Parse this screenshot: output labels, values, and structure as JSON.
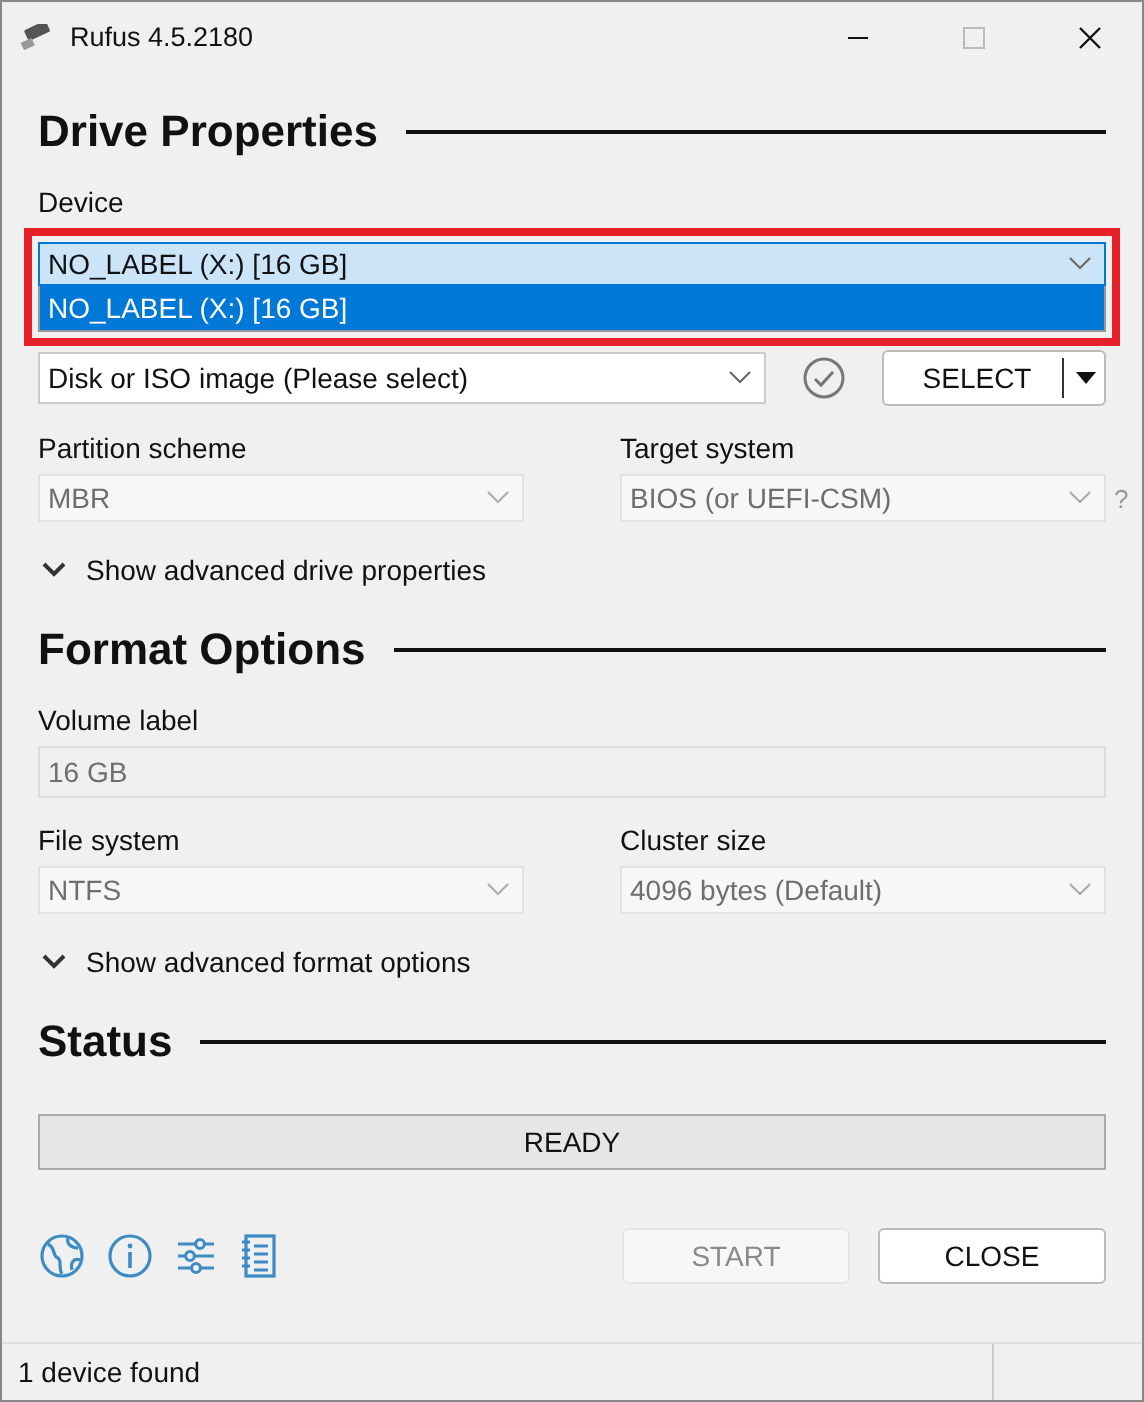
{
  "window": {
    "title": "Rufus 4.5.2180"
  },
  "drive_properties": {
    "heading": "Drive Properties",
    "device": {
      "label": "Device",
      "value": "NO_LABEL (X:) [16 GB]",
      "expanded": true,
      "highlighted": true,
      "options": [
        {
          "label": "NO_LABEL (X:) [16 GB]",
          "selected": true
        }
      ]
    },
    "boot_selection": {
      "value": "Disk or ISO image (Please select)"
    },
    "select_button": "SELECT",
    "fields": [
      {
        "label": "Partition scheme",
        "value": "MBR",
        "disabled": true
      },
      {
        "label": "Target system",
        "value": "BIOS (or UEFI-CSM)",
        "disabled": true,
        "help": "?"
      }
    ],
    "advanced_toggle": {
      "label": "Show advanced drive properties",
      "expanded": false
    }
  },
  "format_options": {
    "heading": "Format Options",
    "volume_label": {
      "label": "Volume label",
      "value": "16 GB",
      "disabled": true
    },
    "fields": [
      {
        "label": "File system",
        "value": "NTFS",
        "disabled": true
      },
      {
        "label": "Cluster size",
        "value": "4096 bytes (Default)",
        "disabled": true
      }
    ],
    "advanced_toggle": {
      "label": "Show advanced format options",
      "expanded": false
    }
  },
  "status": {
    "heading": "Status",
    "progress": {
      "text": "READY"
    }
  },
  "buttons": [
    {
      "label": "START",
      "disabled": true
    },
    {
      "label": "CLOSE",
      "disabled": false
    }
  ],
  "status_bar": {
    "text": "1 device found"
  }
}
